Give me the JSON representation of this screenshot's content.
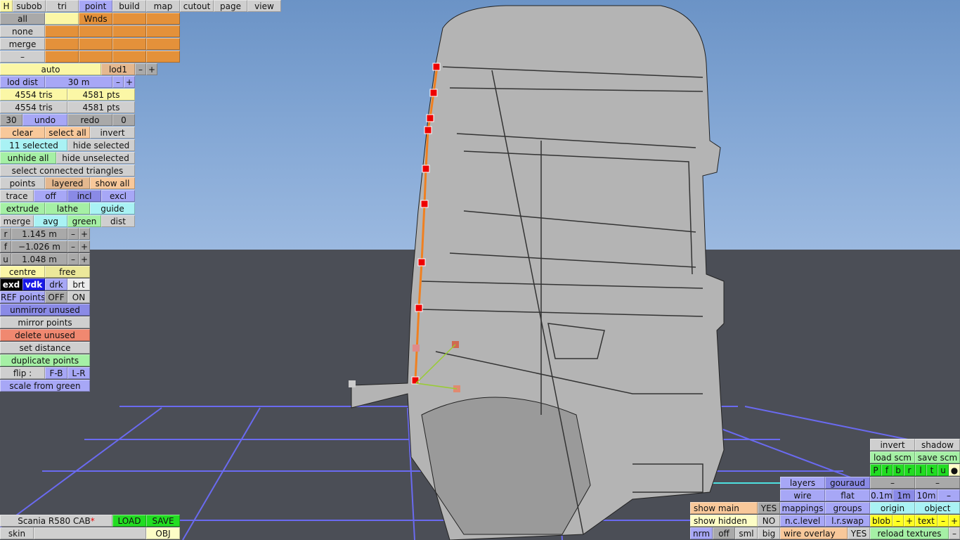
{
  "top_tabs": [
    "H",
    "subob",
    "tri",
    "point",
    "build",
    "map",
    "cutout",
    "page",
    "view"
  ],
  "groups": {
    "rows": [
      "all",
      "none",
      "merge",
      "–"
    ],
    "first_group": "Wnds"
  },
  "lod": {
    "mode": "auto",
    "level": "lod1",
    "minus": "–",
    "plus": "+",
    "dist_label": "lod dist",
    "dist_value": "30 m"
  },
  "stats": {
    "tris1": "4554 tris",
    "pts1": "4581 pts",
    "tris2": "4554 tris",
    "pts2": "4581 pts"
  },
  "undo": {
    "count": "30",
    "undo": "undo",
    "redo": "redo",
    "redo_count": "0"
  },
  "select": {
    "clear": "clear",
    "select_all": "select all",
    "invert": "invert",
    "selected": "11 selected",
    "hide_selected": "hide selected",
    "unhide_all": "unhide all",
    "hide_unselected": "hide unselected",
    "select_connected": "select connected triangles"
  },
  "display": {
    "points": "points",
    "layered": "layered",
    "show_all": "show all"
  },
  "trace": {
    "label": "trace",
    "off": "off",
    "incl": "incl",
    "excl": "excl"
  },
  "tools": {
    "extrude": "extrude",
    "lathe": "lathe",
    "guide": "guide",
    "merge": "merge",
    "avg": "avg",
    "green": "green",
    "dist": "dist"
  },
  "coords": [
    {
      "axis": "r",
      "value": "1.145 m"
    },
    {
      "axis": "f",
      "value": "−1.026 m"
    },
    {
      "axis": "u",
      "value": "1.048 m"
    }
  ],
  "pivot": {
    "centre": "centre",
    "free": "free"
  },
  "shade": [
    "exd",
    "vdk",
    "drk",
    "brt"
  ],
  "ref": {
    "label": "REF points",
    "off": "OFF",
    "on": "ON"
  },
  "actions": {
    "unmirror": "unmirror unused",
    "mirror": "mirror points",
    "delete_unused": "delete unused",
    "set_distance": "set distance",
    "duplicate": "duplicate points",
    "flip": "flip :",
    "fb": "F-B",
    "lr": "L-R",
    "scale": "scale from green"
  },
  "file": {
    "name": "Scania R580 CAB",
    "modified": "*",
    "load": "LOAD",
    "save": "SAVE",
    "skin": "skin",
    "obj": "OBJ"
  },
  "right": {
    "invert": "invert",
    "shadow": "shadow",
    "load_scm": "load scm",
    "save_scm": "save scm",
    "views": [
      "P",
      "f",
      "b",
      "r",
      "l",
      "t",
      "u",
      "●"
    ],
    "layers": "layers",
    "gouraud": "gouraud",
    "wire": "wire",
    "flat": "flat",
    "mappings": "mappings",
    "groups": "groups",
    "nc_level": "n.c.level",
    "lr_swap": "l.r.swap",
    "dash": "–",
    "grid": [
      "0.1m",
      "1m",
      "10m",
      "–"
    ],
    "origin": "origin",
    "object": "object",
    "blob": "blob",
    "text": "text",
    "minus": "–",
    "plus": "+",
    "reload": "reload textures",
    "show_main": "show main",
    "show_main_val": "YES",
    "show_hidden": "show hidden",
    "show_hidden_val": "NO",
    "size": [
      "nrm",
      "off",
      "sml",
      "big"
    ],
    "wire_overlay": "wire overlay",
    "wire_overlay_val": "YES"
  }
}
